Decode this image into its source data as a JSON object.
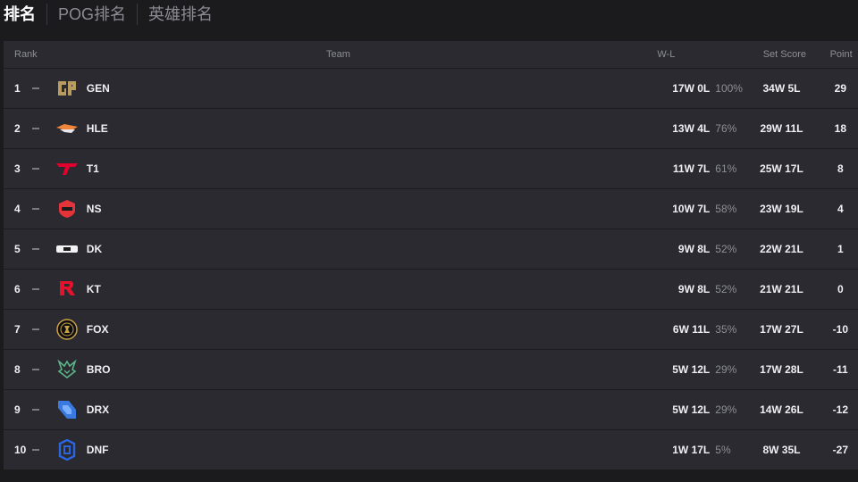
{
  "tabs": [
    "排名",
    "POG排名",
    "英雄排名"
  ],
  "columns": {
    "rank": "Rank",
    "team": "Team",
    "wl": "W-L",
    "set": "Set Score",
    "point": "Point"
  },
  "rows": [
    {
      "rank": "1",
      "team": "GEN",
      "wl": "17W 0L",
      "pct": "100%",
      "set": "34W 5L",
      "point": "29",
      "logo": "gen-logo-icon"
    },
    {
      "rank": "2",
      "team": "HLE",
      "wl": "13W 4L",
      "pct": "76%",
      "set": "29W 11L",
      "point": "18",
      "logo": "hle-logo-icon"
    },
    {
      "rank": "3",
      "team": "T1",
      "wl": "11W 7L",
      "pct": "61%",
      "set": "25W 17L",
      "point": "8",
      "logo": "t1-logo-icon"
    },
    {
      "rank": "4",
      "team": "NS",
      "wl": "10W 7L",
      "pct": "58%",
      "set": "23W 19L",
      "point": "4",
      "logo": "ns-logo-icon"
    },
    {
      "rank": "5",
      "team": "DK",
      "wl": "9W 8L",
      "pct": "52%",
      "set": "22W 21L",
      "point": "1",
      "logo": "dk-logo-icon"
    },
    {
      "rank": "6",
      "team": "KT",
      "wl": "9W 8L",
      "pct": "52%",
      "set": "21W 21L",
      "point": "0",
      "logo": "kt-logo-icon"
    },
    {
      "rank": "7",
      "team": "FOX",
      "wl": "6W 11L",
      "pct": "35%",
      "set": "17W 27L",
      "point": "-10",
      "logo": "fox-logo-icon"
    },
    {
      "rank": "8",
      "team": "BRO",
      "wl": "5W 12L",
      "pct": "29%",
      "set": "17W 28L",
      "point": "-11",
      "logo": "bro-logo-icon"
    },
    {
      "rank": "9",
      "team": "DRX",
      "wl": "5W 12L",
      "pct": "29%",
      "set": "14W 26L",
      "point": "-12",
      "logo": "drx-logo-icon"
    },
    {
      "rank": "10",
      "team": "DNF",
      "wl": "1W 17L",
      "pct": "5%",
      "set": "8W 35L",
      "point": "-27",
      "logo": "dnf-logo-icon"
    }
  ]
}
